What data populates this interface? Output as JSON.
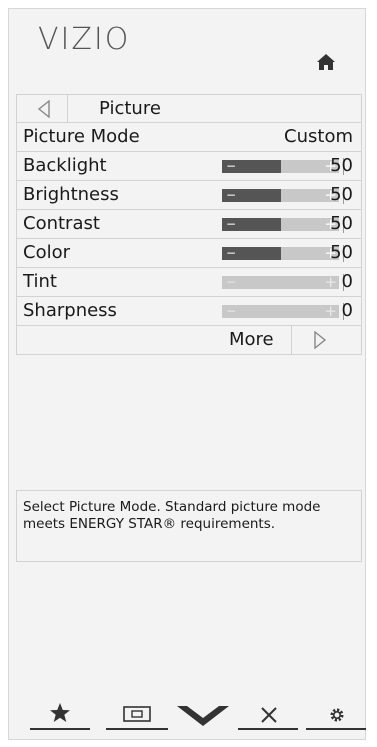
{
  "header": {
    "logo_text": "VIZIO",
    "home_icon": "home-icon"
  },
  "menu": {
    "title": "Picture",
    "picture_mode": {
      "label": "Picture Mode",
      "value": "Custom"
    },
    "sliders": [
      {
        "label": "Backlight",
        "value": "50",
        "level": 0.5,
        "enabled": true
      },
      {
        "label": "Brightness",
        "value": "50",
        "level": 0.5,
        "enabled": true
      },
      {
        "label": "Contrast",
        "value": "50",
        "level": 0.5,
        "enabled": true
      },
      {
        "label": "Color",
        "value": "50",
        "level": 0.5,
        "enabled": true
      },
      {
        "label": "Tint",
        "value": "0",
        "level": 0,
        "enabled": false
      },
      {
        "label": "Sharpness",
        "value": "0",
        "level": 0,
        "enabled": false
      }
    ],
    "more_label": "More"
  },
  "description": "Select Picture Mode. Standard picture mode meets ENERGY STAR® requirements.",
  "bottom_icons": [
    "star-icon",
    "screen-icon",
    "vizio-v-icon",
    "close-icon",
    "gear-icon"
  ],
  "colors": {
    "slider_fill": "#555555",
    "slider_track": "#c8c8c8",
    "panel": "#f3f3f3"
  }
}
